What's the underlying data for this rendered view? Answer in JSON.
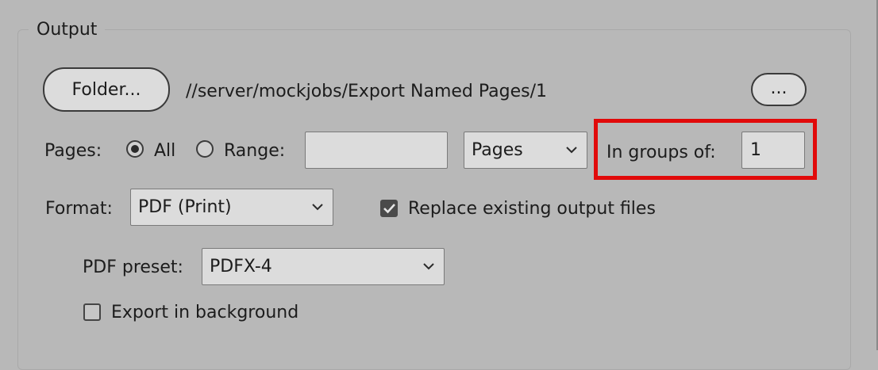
{
  "output": {
    "group_title": "Output",
    "folder_button": "Folder...",
    "path": "//server/mockjobs/Export Named Pages/1",
    "browse_button": "...",
    "pages": {
      "label": "Pages:",
      "option_all": "All",
      "option_range": "Range:",
      "selected": "All",
      "range_value": "",
      "unit_select": "Pages"
    },
    "groups": {
      "label": "In groups of:",
      "value": "1"
    },
    "format": {
      "label": "Format:",
      "value": "PDF (Print)"
    },
    "replace_existing": {
      "label": "Replace existing output files",
      "checked": true
    },
    "pdf_preset": {
      "label": "PDF preset:",
      "value": "PDFX-4"
    },
    "export_background": {
      "label": "Export in background",
      "checked": false
    },
    "colors": {
      "background": "#b8b8b8",
      "highlight": "#e10a0a"
    }
  }
}
